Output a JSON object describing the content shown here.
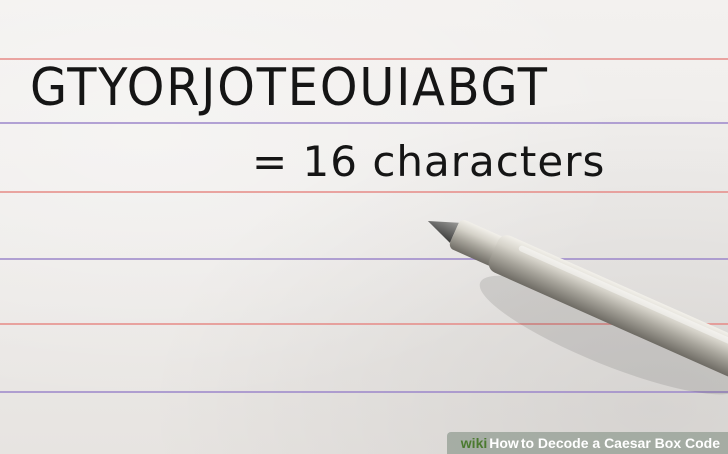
{
  "note": {
    "cipher_text": "GTYORJOTEOUIABGT",
    "count_text": "= 16 characters"
  },
  "caption": {
    "brand": "wiki",
    "how_word": "How",
    "title_rest": " to Decode a Caesar Box Code"
  },
  "colors": {
    "paper": "#efedeb",
    "red_rule": "#e58a86",
    "blue_rule": "#9b86c9",
    "ink": "#151515",
    "pen_metal": "#c9c6bd",
    "caption_bg": "#96a096",
    "wiki_green": "#4b7a2f"
  },
  "objects": [
    "lined-paper",
    "handwritten-text",
    "ballpoint-pen"
  ]
}
